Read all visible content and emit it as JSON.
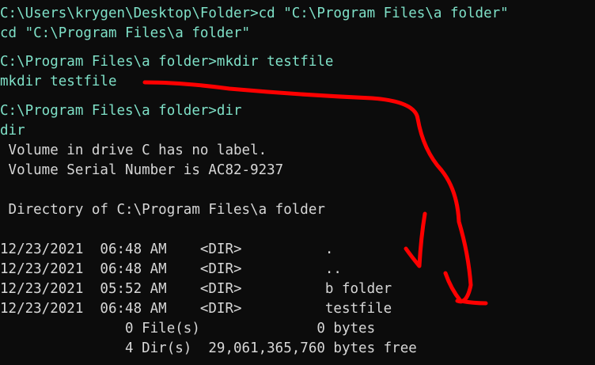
{
  "colors": {
    "background": "#0c0c0c",
    "command_text": "#7fe1c8",
    "output_text": "#d7d7d7",
    "annotation": "#ff0000"
  },
  "terminal": {
    "cmd_cd": "C:\\Users\\krygen\\Desktop\\Folder>cd \"C:\\Program Files\\a folder\"",
    "echo_cd": "cd \"C:\\Program Files\\a folder\"",
    "cmd_mkdir": "C:\\Program Files\\a folder>mkdir testfile",
    "echo_mkdir": "mkdir testfile",
    "cmd_dir": "C:\\Program Files\\a folder>dir",
    "echo_dir": "dir",
    "volume_label": " Volume in drive C has no label.",
    "volume_serial": " Volume Serial Number is AC82-9237",
    "directory_of": " Directory of C:\\Program Files\\a folder",
    "entries": [
      "12/23/2021  06:48 AM    <DIR>          .",
      "12/23/2021  06:48 AM    <DIR>          ..",
      "12/23/2021  05:52 AM    <DIR>          b folder",
      "12/23/2021  06:48 AM    <DIR>          testfile"
    ],
    "files_summary": "               0 File(s)              0 bytes",
    "dirs_summary": "               4 Dir(s)  29,061,365,760 bytes free"
  },
  "annotation": {
    "shape_names": [
      "long-arrow-from-mkdir-to-testfile",
      "short-arrow-to-dot-entries"
    ]
  }
}
